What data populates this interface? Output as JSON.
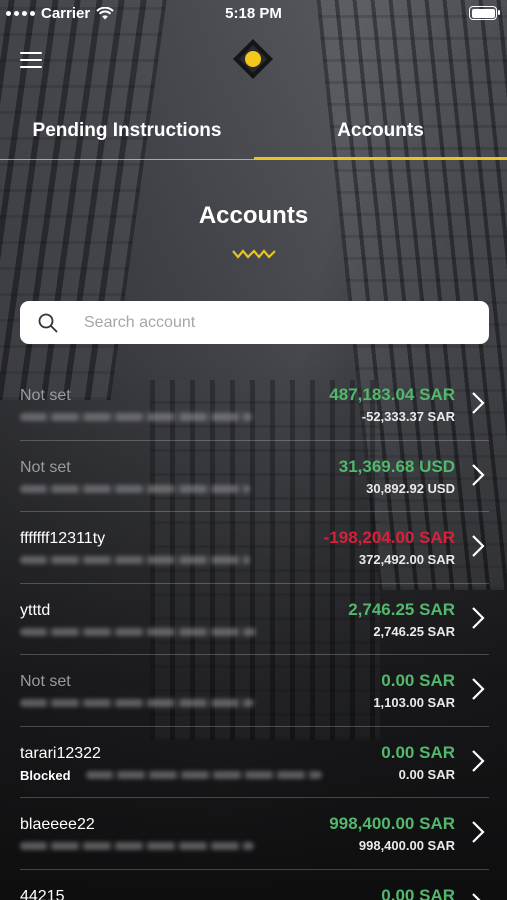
{
  "status_bar": {
    "carrier": "Carrier",
    "time": "5:18 PM"
  },
  "tabs": [
    {
      "label": "Pending Instructions",
      "active": false
    },
    {
      "label": "Accounts",
      "active": true
    }
  ],
  "page_title": "Accounts",
  "search": {
    "placeholder": "Search account",
    "value": ""
  },
  "colors": {
    "accent": "#e6c421",
    "positive": "#52b86c",
    "negative": "#d8203a"
  },
  "accounts": [
    {
      "name": "Not set",
      "balance": "487,183.04 SAR",
      "secondary": "-52,333.37 SAR",
      "status": ""
    },
    {
      "name": "Not set",
      "balance": "31,369.68 USD",
      "secondary": "30,892.92 USD",
      "status": ""
    },
    {
      "name": "fffffff12311ty",
      "balance": "-198,204.00 SAR",
      "secondary": "372,492.00 SAR",
      "status": ""
    },
    {
      "name": "ytttd",
      "balance": "2,746.25 SAR",
      "secondary": "2,746.25 SAR",
      "status": ""
    },
    {
      "name": "Not set",
      "balance": "0.00 SAR",
      "secondary": "1,103.00 SAR",
      "status": ""
    },
    {
      "name": "tarari12322",
      "balance": "0.00 SAR",
      "secondary": "0.00 SAR",
      "status": "Blocked"
    },
    {
      "name": "blaeeee22",
      "balance": "998,400.00 SAR",
      "secondary": "998,400.00 SAR",
      "status": ""
    },
    {
      "name": "44215",
      "balance": "0.00 SAR",
      "secondary": "",
      "status": ""
    }
  ]
}
